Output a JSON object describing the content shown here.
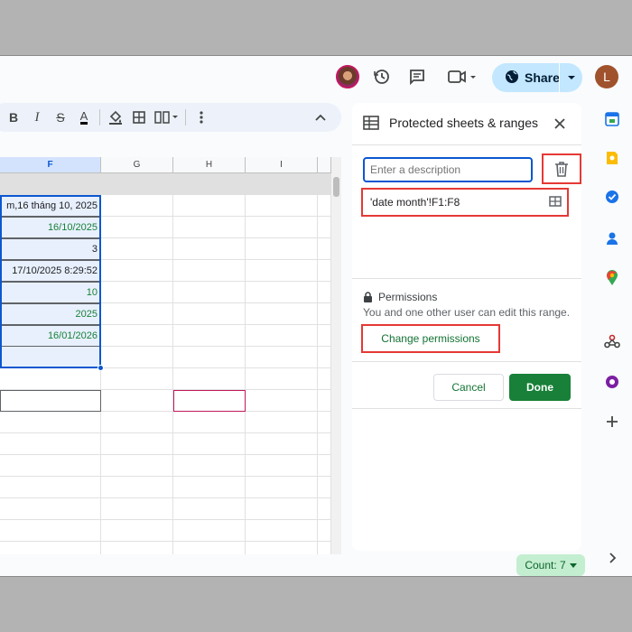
{
  "topbar": {
    "share_label": "Share",
    "user_initial": "L"
  },
  "toolbar": {
    "bold": "B",
    "italic": "I",
    "strikethrough": "S",
    "text_color": "A"
  },
  "sheet": {
    "columns": [
      "F",
      "G",
      "H",
      "I"
    ],
    "cells": [
      {
        "text": "m,16 tháng 10, 2025",
        "color": "#202124"
      },
      {
        "text": "16/10/2025",
        "color": "#188038"
      },
      {
        "text": "3",
        "color": "#202124"
      },
      {
        "text": "17/10/2025 8:29:52",
        "color": "#202124"
      },
      {
        "text": "10",
        "color": "#188038"
      },
      {
        "text": "2025",
        "color": "#188038"
      },
      {
        "text": "16/01/2026",
        "color": "#188038"
      }
    ]
  },
  "status": {
    "count_label": "Count: 7"
  },
  "panel": {
    "title": "Protected sheets & ranges",
    "description_placeholder": "Enter a description",
    "range": "'date month'!F1:F8",
    "permissions_label": "Permissions",
    "permissions_desc": "You and one other user can edit this range.",
    "change_permissions": "Change permissions",
    "cancel": "Cancel",
    "done": "Done"
  },
  "colors": {
    "accent_green": "#188038",
    "highlight_red": "#e53935",
    "selection_blue": "#0b57d0"
  }
}
